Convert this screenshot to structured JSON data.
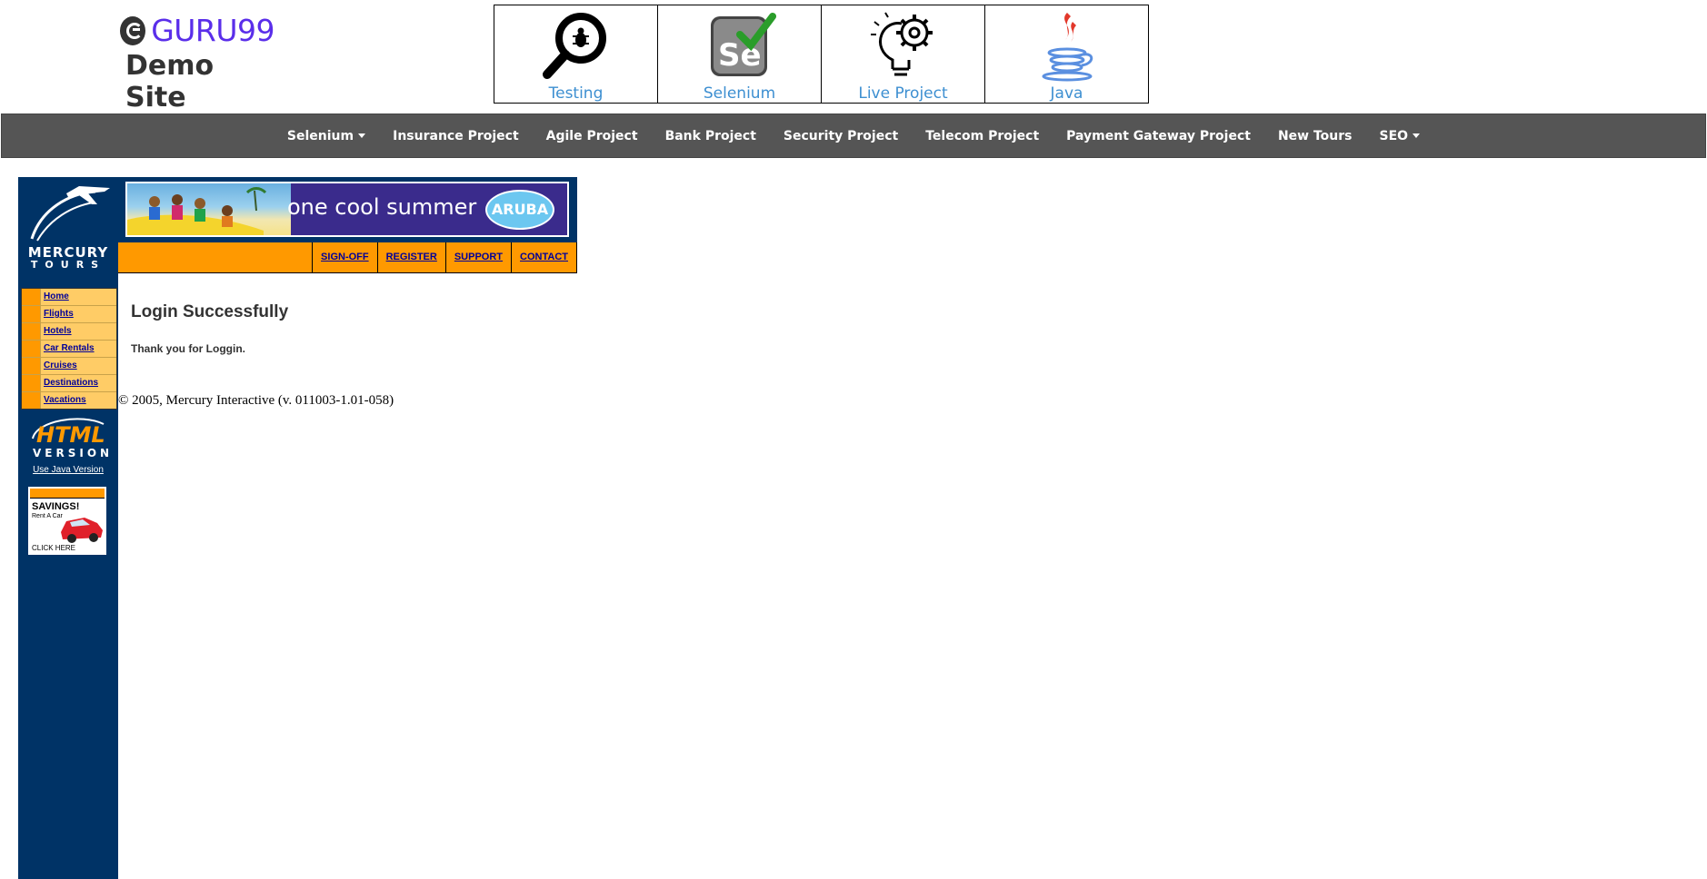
{
  "header": {
    "brand": "GURU99",
    "subtitle": "Demo Site",
    "tiles": [
      {
        "label": "Testing",
        "icon": "magnifier-bug-icon"
      },
      {
        "label": "Selenium",
        "icon": "selenium-icon"
      },
      {
        "label": "Live Project",
        "icon": "lightbulb-gear-icon"
      },
      {
        "label": "Java",
        "icon": "java-cup-icon"
      }
    ]
  },
  "navbar": {
    "items": [
      "Selenium",
      "Insurance Project",
      "Agile Project",
      "Bank Project",
      "Security Project",
      "Telecom Project",
      "Payment Gateway Project",
      "New Tours",
      "SEO"
    ],
    "bg_color": "#555555"
  },
  "mercury": {
    "logo_line1": "MERCURY",
    "logo_line2": "TOURS",
    "side_menu": [
      "Home",
      "Flights",
      "Hotels",
      "Car Rentals",
      "Cruises",
      "Destinations",
      "Vacations"
    ],
    "html_version_line1": "HTML",
    "html_version_line2": "VERSION",
    "java_link": "Use Java Version",
    "ad": {
      "line1": "SAVINGS!",
      "line2": "Rent A Car",
      "line3": "CLICK HERE"
    },
    "banner_text": "one cool summer",
    "banner_badge": "ARUBA",
    "top_links": [
      "SIGN-OFF",
      "REGISTER",
      "SUPPORT",
      "CONTACT"
    ],
    "colors": {
      "sidebar": "#003366",
      "orange": "#ff9900",
      "link": "#000099"
    }
  },
  "content": {
    "title": "Login Successfully",
    "message": "Thank you for Loggin.",
    "copyright": "© 2005, Mercury Interactive (v. 011003-1.01-058)"
  }
}
